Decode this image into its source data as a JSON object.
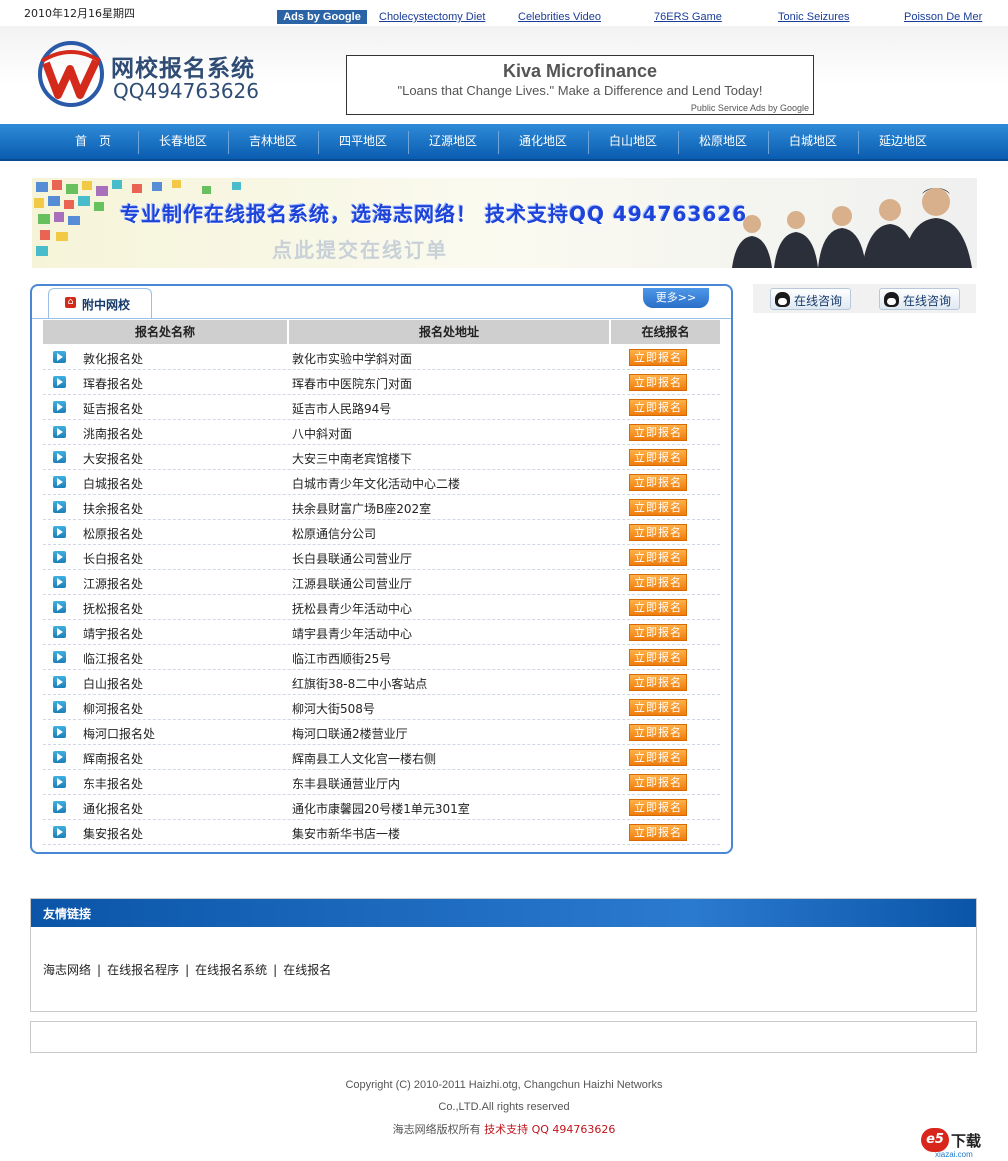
{
  "topbar": {
    "date": "2010年12月16星期四",
    "ads_label": "Ads by Google",
    "ad_links": [
      "Cholecystectomy Diet",
      "Celebrities Video",
      "76ERS Game",
      "Tonic Seizures",
      "Poisson De Mer"
    ]
  },
  "header": {
    "site_name": "网校报名系统",
    "site_qq": "QQ494763626",
    "ad": {
      "title": "Kiva Microfinance",
      "tagline": "\"Loans that Change Lives.\" Make a Difference and Lend Today!",
      "psa": "Public Service Ads by Google"
    }
  },
  "nav": {
    "items": [
      "首　页",
      "长春地区",
      "吉林地区",
      "四平地区",
      "辽源地区",
      "通化地区",
      "白山地区",
      "松原地区",
      "白城地区",
      "延边地区"
    ]
  },
  "banner": {
    "main_text": "专业制作在线报名系统，选海志网络！ 技术支持QQ 494763626",
    "sub_text": "点此提交在线订单"
  },
  "panel": {
    "tab_title": "附中网校",
    "more_label": "更多>>",
    "columns": [
      "报名处名称",
      "报名处地址",
      "在线报名"
    ],
    "button_label": "立即报名",
    "rows": [
      {
        "name": "敦化报名处",
        "address": "敦化市实验中学斜对面"
      },
      {
        "name": "珲春报名处",
        "address": "珲春市中医院东门对面"
      },
      {
        "name": "延吉报名处",
        "address": "延吉市人民路94号"
      },
      {
        "name": "洮南报名处",
        "address": "八中斜对面"
      },
      {
        "name": "大安报名处",
        "address": "大安三中南老宾馆楼下"
      },
      {
        "name": "白城报名处",
        "address": "白城市青少年文化活动中心二楼"
      },
      {
        "name": "扶余报名处",
        "address": "扶余县财富广场B座202室"
      },
      {
        "name": "松原报名处",
        "address": "松原通信分公司"
      },
      {
        "name": "长白报名处",
        "address": "长白县联通公司营业厅"
      },
      {
        "name": "江源报名处",
        "address": "江源县联通公司营业厅"
      },
      {
        "name": "抚松报名处",
        "address": "抚松县青少年活动中心"
      },
      {
        "name": "靖宇报名处",
        "address": "靖宇县青少年活动中心"
      },
      {
        "name": "临江报名处",
        "address": "临江市西顺街25号"
      },
      {
        "name": "白山报名处",
        "address": "红旗街38-8二中小客站点"
      },
      {
        "name": "柳河报名处",
        "address": "柳河大街508号"
      },
      {
        "name": "梅河口报名处",
        "address": "梅河口联通2楼营业厅"
      },
      {
        "name": "辉南报名处",
        "address": "辉南县工人文化宫一楼右侧"
      },
      {
        "name": "东丰报名处",
        "address": "东丰县联通营业厅内"
      },
      {
        "name": "通化报名处",
        "address": "通化市康馨园20号楼1单元301室"
      },
      {
        "name": "集安报名处",
        "address": "集安市新华书店一楼"
      }
    ]
  },
  "side": {
    "qq_buttons": [
      "在线咨询",
      "在线咨询"
    ]
  },
  "links": {
    "title": "友情链接",
    "items": [
      "海志网络",
      "在线报名程序",
      "在线报名系统",
      "在线报名"
    ],
    "separator": "|"
  },
  "footer": {
    "line1": "Copyright (C) 2010-2011 Haizhi.otg, Changchun Haizhi Networks",
    "line2": "Co.,LTD.All rights reserved",
    "line3_prefix": "海志网络版权所有",
    "line3_tech": "技术支持 QQ 494763626"
  },
  "watermark": {
    "mark": "e5",
    "text": "下载",
    "url": "xiazai.com"
  },
  "colors": {
    "nav_blue": "#1a6fc6",
    "panel_border": "#4a88d6",
    "button_orange": "#f39424",
    "footer_red": "#c0151b"
  },
  "icons": {
    "logo": "w-logo-icon",
    "tab": "home-icon",
    "row": "play-icon",
    "qq": "qq-penguin-icon"
  }
}
